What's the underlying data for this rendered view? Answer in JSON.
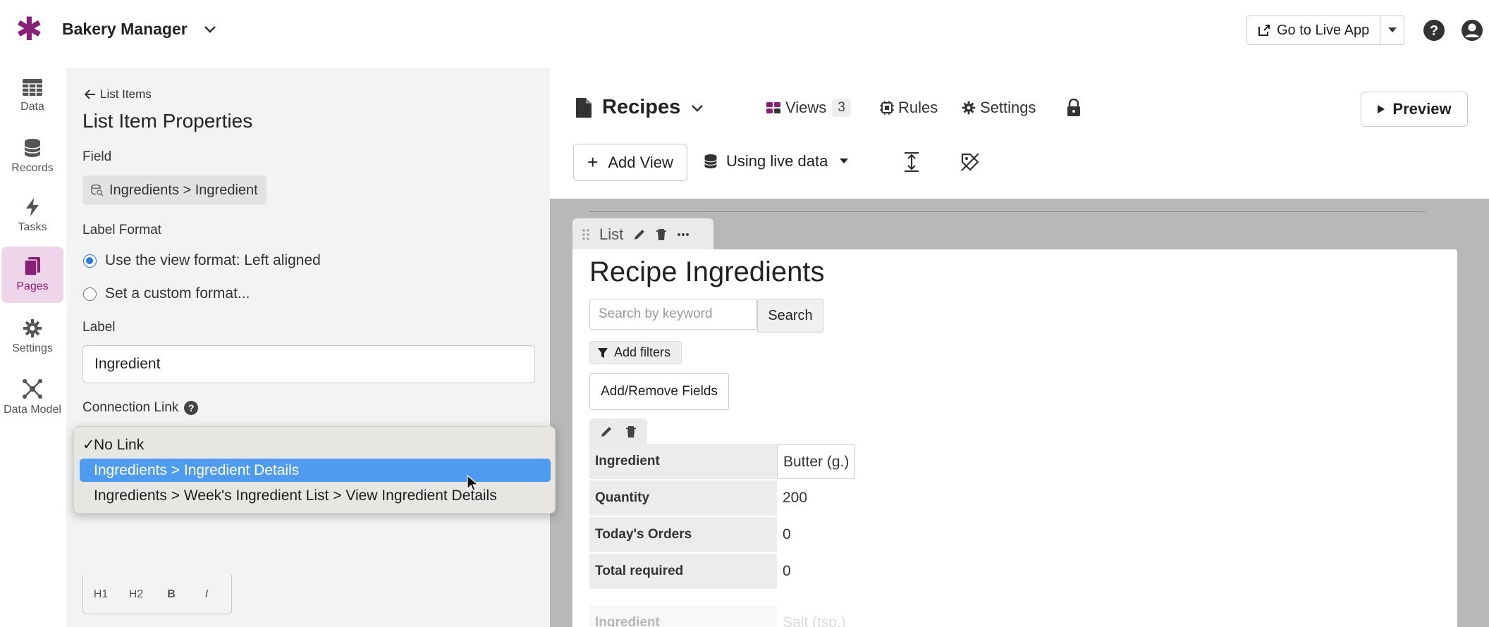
{
  "header": {
    "app_name": "Bakery Manager",
    "live_app_label": "Go to Live App",
    "brand_color": "#8a1f79"
  },
  "nav": {
    "items": [
      {
        "label": "Data",
        "icon": "table-icon"
      },
      {
        "label": "Records",
        "icon": "database-icon"
      },
      {
        "label": "Tasks",
        "icon": "bolt-icon"
      },
      {
        "label": "Pages",
        "icon": "pages-icon",
        "active": true
      },
      {
        "label": "Settings",
        "icon": "gear-icon"
      },
      {
        "label": "Data Model",
        "icon": "network-icon"
      }
    ]
  },
  "props": {
    "back_label": "List Items",
    "title": "List Item Properties",
    "field_label": "Field",
    "field_value": "Ingredients > Ingredient",
    "label_format_label": "Label Format",
    "radio_view_format": "Use the view format: Left aligned",
    "radio_custom_format": "Set a custom format...",
    "label_label": "Label",
    "label_value": "Ingredient",
    "connection_link_label": "Connection Link",
    "help_glyph": "?",
    "toolbar": {
      "h1": "H1",
      "h2": "H2",
      "bold": "B",
      "italic": "I"
    }
  },
  "dropdown": {
    "options": [
      {
        "label": "No Link",
        "checked": true
      },
      {
        "label": "Ingredients > Ingredient Details",
        "highlighted": true
      },
      {
        "label": "Ingredients > Week's Ingredient List > View Ingredient Details"
      }
    ],
    "highlight_color": "#4f9bf0"
  },
  "page": {
    "title": "Recipes",
    "views_label": "Views",
    "views_count": "3",
    "rules_label": "Rules",
    "settings_label": "Settings",
    "preview_label": "Preview",
    "add_view_label": "Add View",
    "live_data_label": "Using live data"
  },
  "view": {
    "tab_label": "List",
    "title": "Recipe Ingredients",
    "search_placeholder": "Search by keyword",
    "search_button": "Search",
    "filters_button": "Add filters",
    "add_remove_button": "Add/Remove Fields",
    "rows": [
      {
        "label": "Ingredient",
        "value": "Butter (g.)"
      },
      {
        "label": "Quantity",
        "value": "200"
      },
      {
        "label": "Today's Orders",
        "value": "0"
      },
      {
        "label": "Total required",
        "value": "0"
      }
    ],
    "next_row": {
      "label": "Ingredient",
      "value": "Salt (tsp.)"
    }
  }
}
